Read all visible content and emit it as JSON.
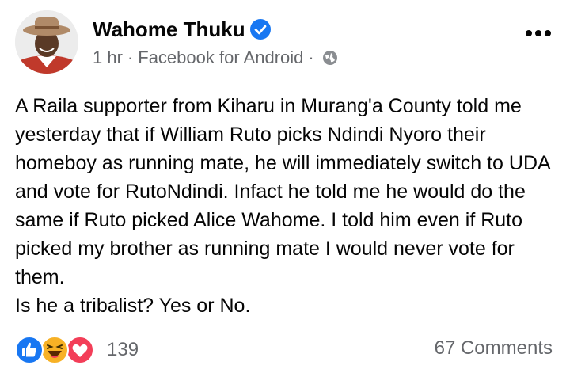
{
  "author": {
    "name": "Wahome Thuku",
    "verified": true
  },
  "meta": {
    "time": "1 hr",
    "separator": "·",
    "source": "Facebook for Android",
    "privacy_icon": "globe-icon"
  },
  "post": {
    "text": "A Raila supporter from Kiharu in Murang'a County told me yesterday that if William Ruto picks Ndindi Nyoro their homeboy as running mate, he will immediately switch to UDA and vote for RutoNdindi. Infact he told me he would do the same if Ruto picked Alice Wahome. I told him even if Ruto picked my brother as running mate I would never vote for them.\nIs he a tribalist? Yes or No."
  },
  "reactions": {
    "icons": [
      "like-icon",
      "haha-icon",
      "love-icon"
    ],
    "count": "139"
  },
  "comments": {
    "label": "67 Comments"
  },
  "colors": {
    "verified_blue": "#1877f2",
    "meta_gray": "#65676b",
    "love_red": "#f33e58",
    "haha_yellow": "#f7b125"
  }
}
